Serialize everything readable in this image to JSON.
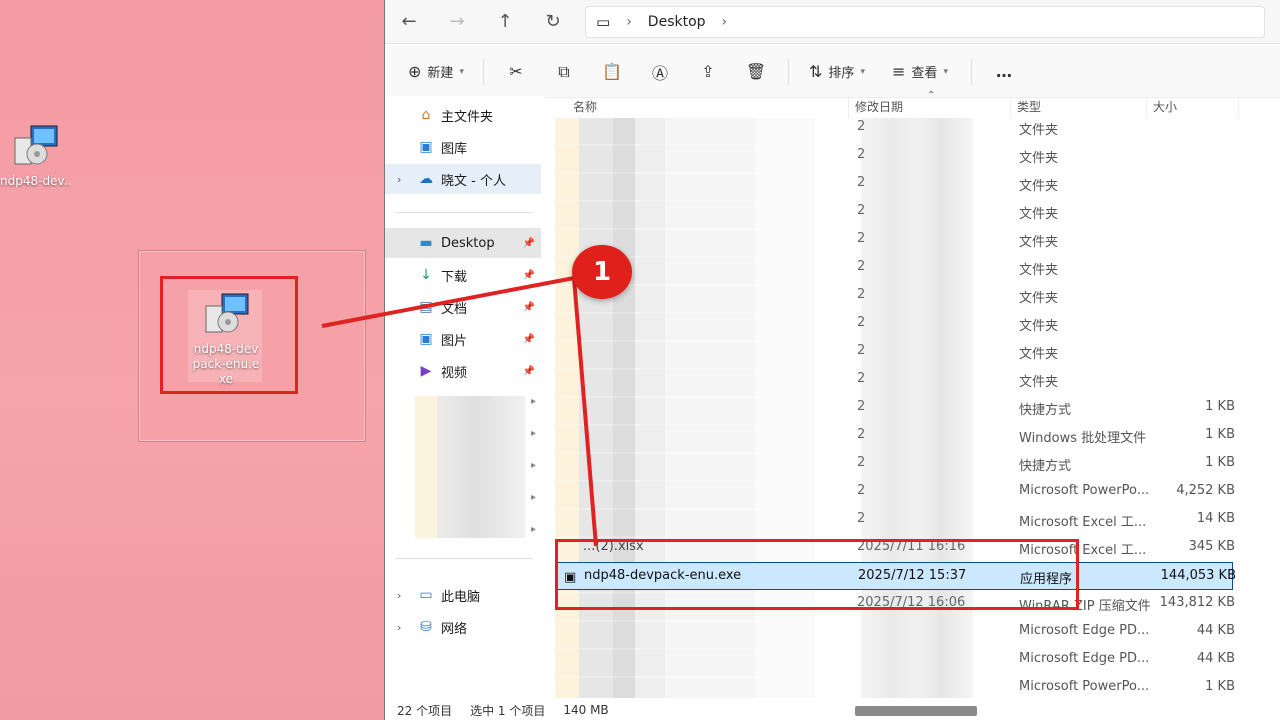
{
  "desktop": {
    "icon_label": "ndp48-dev...",
    "zoom_label": "ndp48-devpack-enu.exe"
  },
  "explorer": {
    "address": {
      "location": "Desktop",
      "icons": [
        "back-icon",
        "forward-icon",
        "up-icon",
        "refresh-icon",
        "monitor-icon"
      ]
    },
    "toolbar": {
      "new_label": "新建",
      "sort_label": "排序",
      "view_label": "查看",
      "more_label": "…"
    },
    "nav": {
      "items": [
        {
          "label": "主文件夹",
          "icon": "home-icon"
        },
        {
          "label": "图库",
          "icon": "gallery-icon"
        },
        {
          "label": "晓文 - 个人",
          "icon": "cloud-icon"
        },
        {
          "label": "Desktop",
          "icon": "desktop-icon"
        },
        {
          "label": "下载",
          "icon": "download-icon"
        },
        {
          "label": "文档",
          "icon": "document-icon"
        },
        {
          "label": "图片",
          "icon": "picture-icon"
        },
        {
          "label": "视频",
          "icon": "video-icon"
        },
        {
          "label": "此电脑",
          "icon": "pc-icon"
        },
        {
          "label": "网络",
          "icon": "network-icon"
        }
      ]
    },
    "columns": {
      "name": "名称",
      "date": "修改日期",
      "type": "类型",
      "size": "大小"
    },
    "rows": [
      {
        "name": "",
        "date": "2",
        "type": "文件夹",
        "size": ""
      },
      {
        "name": "",
        "date": "2",
        "type": "文件夹",
        "size": ""
      },
      {
        "name": "",
        "date": "2",
        "type": "文件夹",
        "size": ""
      },
      {
        "name": "",
        "date": "2",
        "type": "文件夹",
        "size": ""
      },
      {
        "name": "",
        "date": "2",
        "type": "文件夹",
        "size": ""
      },
      {
        "name": "",
        "date": "2",
        "type": "文件夹",
        "size": ""
      },
      {
        "name": "",
        "date": "2",
        "type": "文件夹",
        "size": ""
      },
      {
        "name": "",
        "date": "2",
        "type": "文件夹",
        "size": ""
      },
      {
        "name": "",
        "date": "2",
        "type": "文件夹",
        "size": ""
      },
      {
        "name": "",
        "date": "2",
        "type": "文件夹",
        "size": ""
      },
      {
        "name": "",
        "date": "2",
        "type": "快捷方式",
        "size": "1 KB"
      },
      {
        "name": "",
        "date": "2",
        "type": "Windows 批处理文件",
        "size": "1 KB"
      },
      {
        "name": "",
        "date": "2",
        "type": "快捷方式",
        "size": "1 KB"
      },
      {
        "name": "",
        "date": "2",
        "type": "Microsoft PowerPo...",
        "size": "4,252 KB"
      },
      {
        "name": "",
        "date": "2",
        "type": "Microsoft Excel 工...",
        "size": "14 KB"
      },
      {
        "name": "...(2).xlsx",
        "date": "2025/7/11 16:16",
        "type": "Microsoft Excel 工...",
        "size": "345 KB"
      },
      {
        "name": "ndp48-devpack-enu.exe",
        "date": "2025/7/12 15:37",
        "type": "应用程序",
        "size": "144,053 KB",
        "selected": true
      },
      {
        "name": "",
        "date": "2025/7/12 16:06",
        "type": "WinRAR ZIP 压缩文件",
        "size": "143,812 KB"
      },
      {
        "name": "",
        "date": "",
        "type": "Microsoft Edge PD...",
        "size": "44 KB"
      },
      {
        "name": "",
        "date": "",
        "type": "Microsoft Edge PD...",
        "size": "44 KB"
      },
      {
        "name": "",
        "date": "",
        "type": "Microsoft PowerPo...",
        "size": "1 KB"
      }
    ],
    "status": {
      "count": "22 个项目",
      "selected": "选中 1 个项目",
      "size": "140 MB"
    }
  },
  "annotation": {
    "step": "1"
  }
}
